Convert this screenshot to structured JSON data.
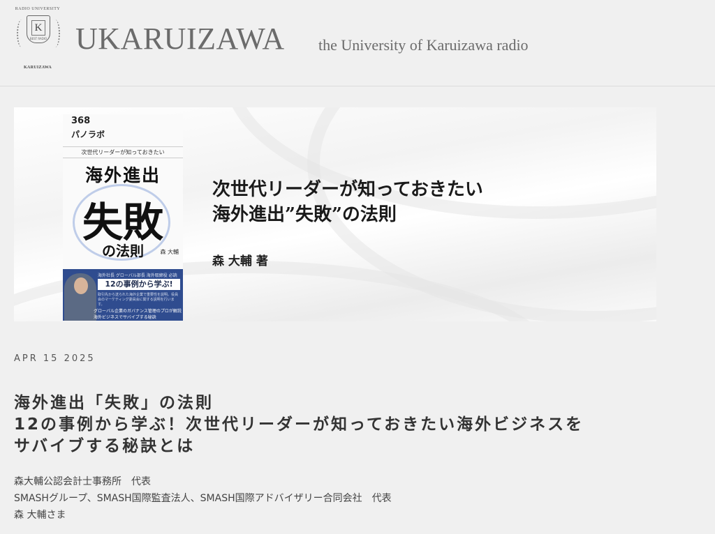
{
  "header": {
    "crest_top": "RADIO UNIVERSITY",
    "crest_letter": "K",
    "crest_sub": "BEST RADIO",
    "crest_bottom": "KARUIZAWA",
    "brand": "UKARUIZAWA",
    "tagline": "the University of Karuizawa radio"
  },
  "hero": {
    "book": {
      "logo": "368",
      "logo2": "パノラボ",
      "subtitle": "次世代リーダーが知っておきたい",
      "title_line1": "海外進出",
      "title_line2": "失敗",
      "title_line3": "の法則",
      "author": "森 大輔",
      "band_line": "海外社長 グローバル部長 海外取締役 必読",
      "band_box": "12の事例から学ぶ!",
      "band_text": "取引先から送られた海外企業で重要性を説明。役員会のマーケティング委員会に関する説明を行います。",
      "band_foot1": "グローバル企業のガバナンス管理のプロが解説",
      "band_foot2": "海外ビジネスでサバイブする秘訣"
    },
    "title_line1": "次世代リーダーが知っておきたい",
    "title_line2": "海外進出”失敗”の法則",
    "author": "森 大輔 著"
  },
  "post": {
    "date": "APR 15 2025",
    "title_lines": [
      "海外進出「失敗」の法則",
      "12の事例から学ぶ！次世代リーダーが知っておきたい海外ビジネスを",
      "サバイブする秘訣とは"
    ],
    "meta_lines": [
      "森大輔公認会計士事務所　代表",
      "SMASHグループ、SMASH国際監査法人、SMASH国際アドバイザリー合同会社　代表",
      "森 大輔さま"
    ]
  }
}
